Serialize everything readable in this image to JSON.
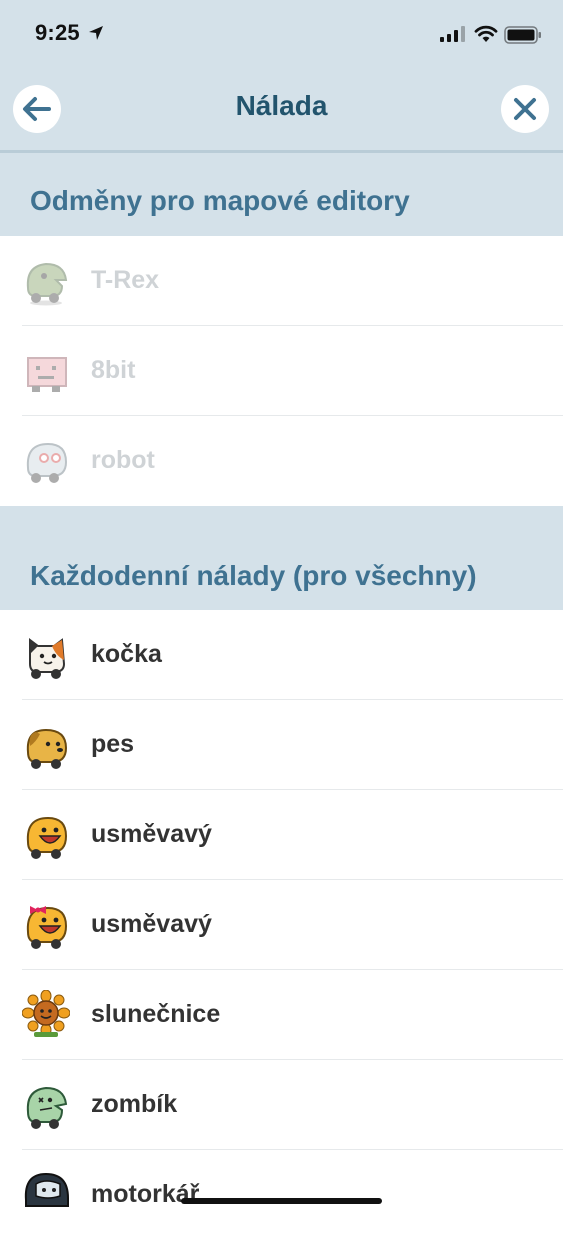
{
  "status_bar": {
    "time": "9:25"
  },
  "header": {
    "title": "Nálada"
  },
  "sections": [
    {
      "title": "Odměny pro mapové editory",
      "items": [
        {
          "label": "T-Rex",
          "icon": "trex-mood-icon",
          "enabled": false
        },
        {
          "label": "8bit",
          "icon": "8bit-mood-icon",
          "enabled": false
        },
        {
          "label": "robot",
          "icon": "robot-mood-icon",
          "enabled": false
        }
      ]
    },
    {
      "title": "Každodenní nálady (pro všechny)",
      "items": [
        {
          "label": "kočka",
          "icon": "cat-mood-icon",
          "enabled": true
        },
        {
          "label": "pes",
          "icon": "dog-mood-icon",
          "enabled": true
        },
        {
          "label": "usměvavý",
          "icon": "smiley-mood-icon",
          "enabled": true
        },
        {
          "label": "usměvavý",
          "icon": "smiley-bow-mood-icon",
          "enabled": true
        },
        {
          "label": "slunečnice",
          "icon": "sunflower-mood-icon",
          "enabled": true
        },
        {
          "label": "zombík",
          "icon": "zombie-mood-icon",
          "enabled": true
        },
        {
          "label": "motorkář",
          "icon": "biker-mood-icon",
          "enabled": true
        }
      ]
    }
  ],
  "colors": {
    "header_bg": "#d4e1e9",
    "title": "#22546d",
    "section_title": "#3f7291",
    "text": "#333333",
    "disabled_text": "#cfd3d6"
  }
}
